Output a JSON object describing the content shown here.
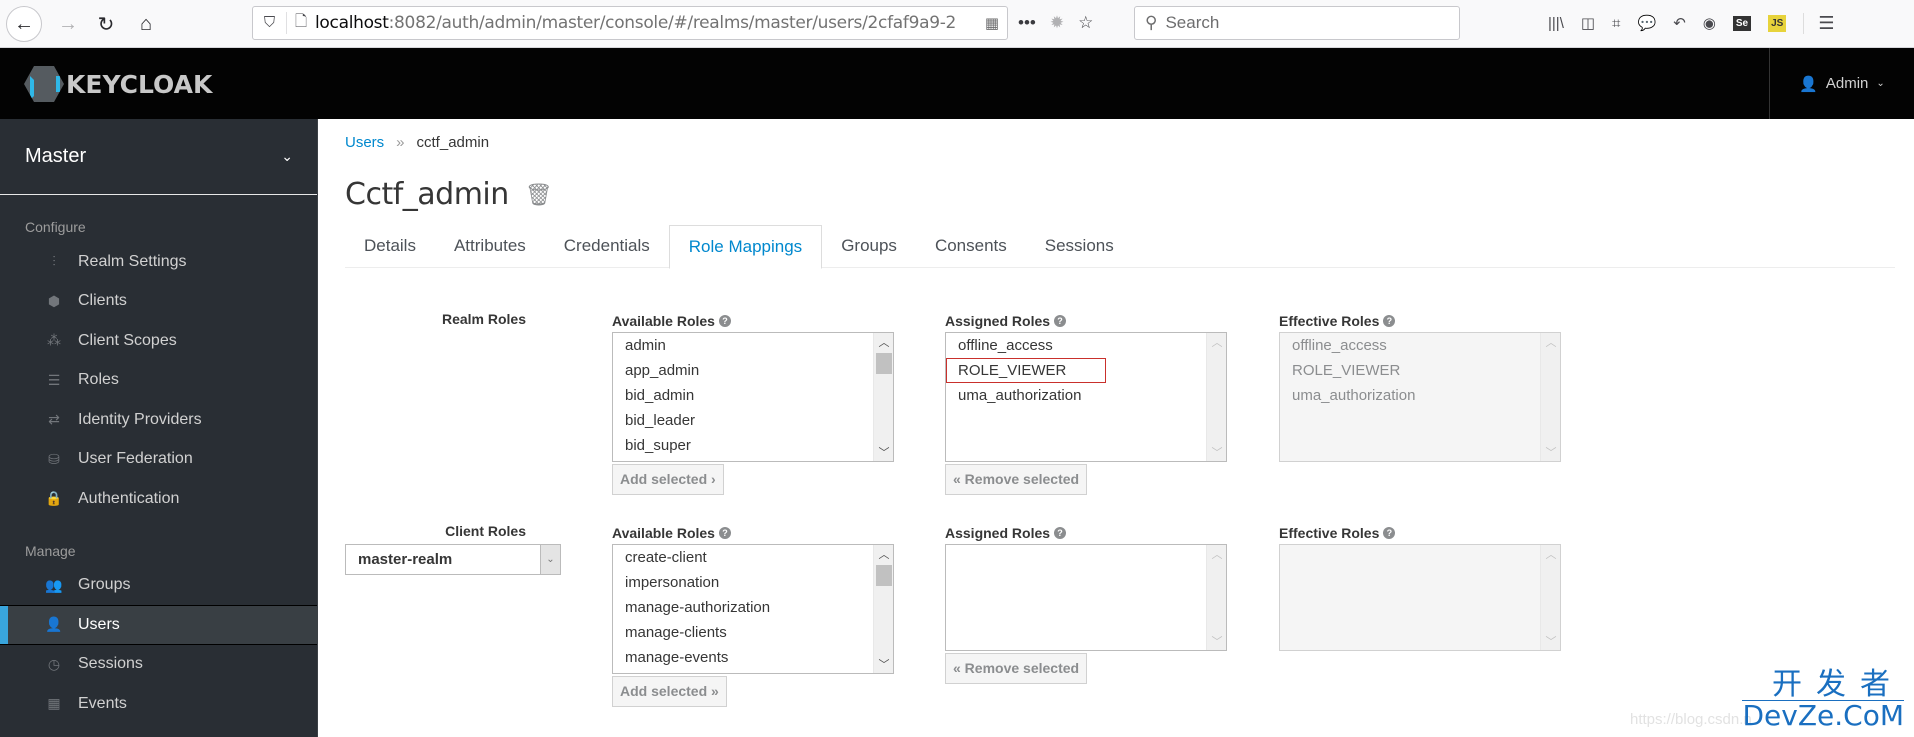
{
  "browser": {
    "url_host": "localhost",
    "url_rest": ":8082/auth/admin/master/console/#/realms/master/users/2cfaf9a9-2",
    "search_placeholder": "Search",
    "icons": [
      "back-icon",
      "forward-icon",
      "reload-icon",
      "home-icon",
      "shield-icon",
      "page-icon",
      "qr-code-icon",
      "more-icon",
      "bug-icon",
      "bookmark-star-icon",
      "library-icon",
      "sidebar-icon",
      "crop-icon",
      "chat-icon",
      "undo-icon",
      "account-icon",
      "selenium-icon",
      "js-icon",
      "menu-icon"
    ],
    "selenium_label": "Se",
    "js_label": "JS"
  },
  "header": {
    "brand": "KEYCLOAK",
    "user": "Admin"
  },
  "sidebar": {
    "realm": "Master",
    "configure_label": "Configure",
    "configure_items": [
      {
        "label": "Realm Settings",
        "icon": "sliders-icon"
      },
      {
        "label": "Clients",
        "icon": "cube-icon"
      },
      {
        "label": "Client Scopes",
        "icon": "cubes-icon"
      },
      {
        "label": "Roles",
        "icon": "list-icon"
      },
      {
        "label": "Identity Providers",
        "icon": "exchange-icon"
      },
      {
        "label": "User Federation",
        "icon": "database-icon"
      },
      {
        "label": "Authentication",
        "icon": "lock-icon"
      }
    ],
    "manage_label": "Manage",
    "manage_items": [
      {
        "label": "Groups",
        "icon": "users-icon"
      },
      {
        "label": "Users",
        "icon": "user-icon",
        "active": true
      },
      {
        "label": "Sessions",
        "icon": "clock-icon"
      },
      {
        "label": "Events",
        "icon": "calendar-icon"
      }
    ]
  },
  "main": {
    "breadcrumb": {
      "parent": "Users",
      "separator": "»",
      "current": "cctf_admin"
    },
    "title": "Cctf_admin",
    "tabs": [
      {
        "label": "Details"
      },
      {
        "label": "Attributes"
      },
      {
        "label": "Credentials"
      },
      {
        "label": "Role Mappings",
        "active": true
      },
      {
        "label": "Groups"
      },
      {
        "label": "Consents"
      },
      {
        "label": "Sessions"
      }
    ],
    "realm_roles": {
      "label": "Realm Roles",
      "available_label": "Available Roles",
      "available": [
        "admin",
        "app_admin",
        "bid_admin",
        "bid_leader",
        "bid_super"
      ],
      "add_button": "Add selected ›",
      "assigned_label": "Assigned Roles",
      "assigned": [
        "offline_access",
        "ROLE_VIEWER",
        "uma_authorization"
      ],
      "highlighted": "ROLE_VIEWER",
      "remove_button": "« Remove selected",
      "effective_label": "Effective Roles",
      "effective": [
        "offline_access",
        "ROLE_VIEWER",
        "uma_authorization"
      ]
    },
    "client_roles": {
      "label": "Client Roles",
      "client_select": "master-realm",
      "available_label": "Available Roles",
      "available": [
        "create-client",
        "impersonation",
        "manage-authorization",
        "manage-clients",
        "manage-events"
      ],
      "add_button": "Add selected »",
      "assigned_label": "Assigned Roles",
      "assigned": [],
      "remove_button": "« Remove selected",
      "effective_label": "Effective Roles",
      "effective": []
    }
  },
  "watermark": {
    "cn": "开发者",
    "en": "DevZe.CoM",
    "faint": "https://blog.csdn.n"
  }
}
